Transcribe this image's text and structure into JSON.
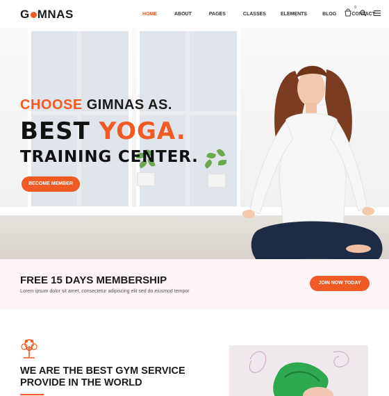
{
  "brand": {
    "logo_pre": "G",
    "logo_post": "MNAS",
    "accent_color": "#f15a24"
  },
  "nav": {
    "items": [
      {
        "label": "HOME",
        "active": true
      },
      {
        "label": "ABOUT",
        "active": false
      },
      {
        "label": "PAGES",
        "active": false
      },
      {
        "label": "CLASSES",
        "active": false
      },
      {
        "label": "ELEMENTS",
        "active": false
      },
      {
        "label": "BLOG",
        "active": false
      },
      {
        "label": "CONTACT",
        "active": false
      }
    ],
    "cart_count": "0",
    "icons": [
      "cart-icon",
      "search-icon",
      "menu-icon"
    ]
  },
  "hero": {
    "line1_accent": "CHOOSE",
    "line1_rest": " GIMNAS AS.",
    "line2_pre": "BEST ",
    "line2_accent": "YOGA.",
    "line3": "TRAINING CENTER.",
    "button_label": "BECOME MEMBER"
  },
  "offer": {
    "title": "FREE 15 DAYS MEMBERSHIP",
    "text": "Lorem ipsum dolor sit amet, consectetur adipiscing elit sed do eiusmod tempor",
    "button_label": "JOIN NOW TODAY"
  },
  "about": {
    "title_line1": "WE ARE THE BEST GYM SERVICE",
    "title_line2": "PROVIDE IN THE WORLD",
    "icon": "tree-icon"
  }
}
